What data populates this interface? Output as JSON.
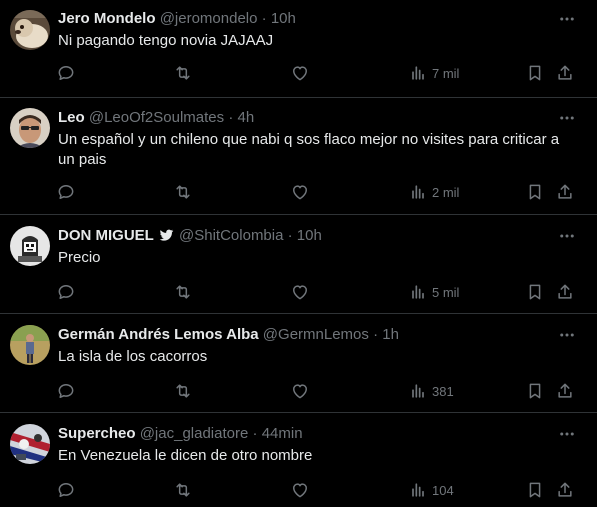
{
  "tweets": [
    {
      "name": "Jero Mondelo",
      "handle": "@jeromondelo",
      "time": "10h",
      "text": "Ni pagando tengo novia JAJAAJ",
      "views": "7 mil",
      "verified": false
    },
    {
      "name": "Leo",
      "handle": "@LeoOf2Soulmates",
      "time": "4h",
      "text": "Un español y un chileno que nabi q sos flaco mejor no visites para criticar a un pais",
      "views": "2 mil",
      "verified": false
    },
    {
      "name": "DON MIGUEL",
      "handle": "@ShitColombia",
      "time": "10h",
      "text": "Precio",
      "views": "5 mil",
      "verified": true
    },
    {
      "name": "Germán Andrés Lemos Alba",
      "handle": "@GermnLemos",
      "time": "1h",
      "text": "La isla de los cacorros",
      "views": "381",
      "verified": false
    },
    {
      "name": "Supercheo",
      "handle": "@jac_gladiatore",
      "time": "44min",
      "text": "En Venezuela le dicen de otro nombre",
      "views": "104",
      "verified": false
    }
  ],
  "separator": "·",
  "colors": {
    "background": "#000000",
    "text": "#e7e9ea",
    "muted": "#71767b",
    "border": "#2f3336"
  },
  "icons": {
    "reply": "reply-icon",
    "retweet": "retweet-icon",
    "like": "like-icon",
    "views": "views-icon",
    "bookmark": "bookmark-icon",
    "share": "share-icon",
    "more": "more-icon",
    "verified": "verified-bird-icon"
  }
}
